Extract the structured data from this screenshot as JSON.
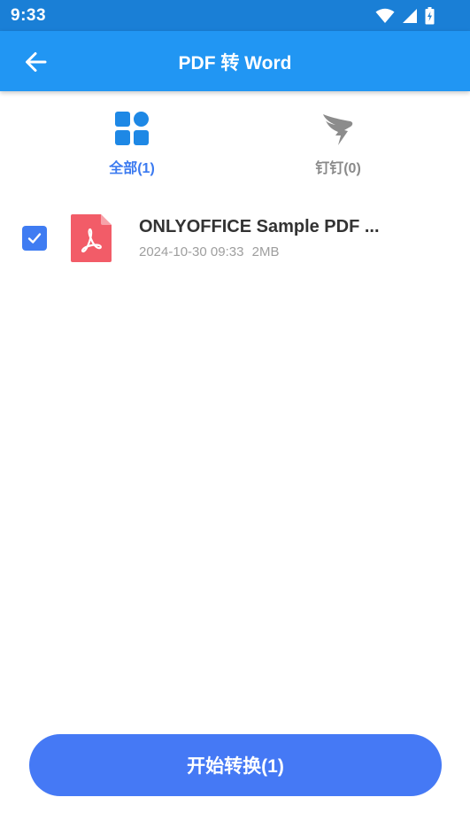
{
  "status_bar": {
    "time": "9:33",
    "icons": [
      "wifi-icon",
      "cellular-signal-icon",
      "battery-charging-icon"
    ]
  },
  "app_bar": {
    "back_icon": "arrow-back-icon",
    "title": "PDF 转 Word"
  },
  "tabs": [
    {
      "label": "全部(1)",
      "icon": "grid-icon",
      "selected": true
    },
    {
      "label": "钉钉(0)",
      "icon": "dingtalk-logo-icon",
      "selected": false
    }
  ],
  "files": [
    {
      "name": "ONLYOFFICE Sample PDF ...",
      "date": "2024-10-30 09:33",
      "size": "2MB",
      "checked": true,
      "icon": "pdf-file-icon"
    }
  ],
  "convert_button": {
    "label": "开始转换(1)"
  },
  "colors": {
    "status_bar": "#1a7fd6",
    "app_bar": "#2196f3",
    "accent": "#3b7af0",
    "checkbox": "#3f7cf2",
    "pdf_red": "#f25c68",
    "button": "#4579f5",
    "inactive_text": "#8a8a8a"
  }
}
